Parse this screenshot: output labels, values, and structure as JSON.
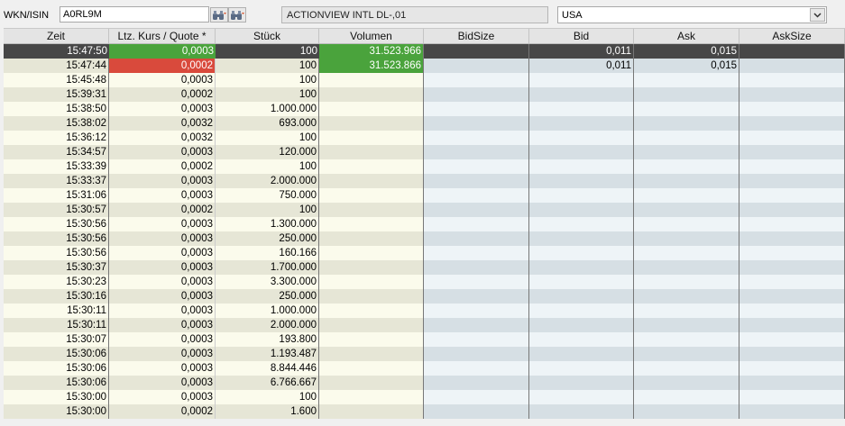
{
  "toolbar": {
    "wkn_label": "WKN/ISIN",
    "wkn_value": "A0RL9M",
    "instrument_name": "ACTIONVIEW INTL   DL-,01",
    "exchange": "USA"
  },
  "columns": [
    "Zeit",
    "Ltz. Kurs / Quote *",
    "Stück",
    "Volumen",
    "BidSize",
    "Bid",
    "Ask",
    "AskSize"
  ],
  "rows": [
    {
      "zeit": "15:47:50",
      "kurs": "0,0003",
      "stueck": "100",
      "volumen": "31.523.966",
      "bidsize": "",
      "bid": "0,011",
      "ask": "0,015",
      "asksize": "",
      "selected": true,
      "kurs_state": "up"
    },
    {
      "zeit": "15:47:44",
      "kurs": "0,0002",
      "stueck": "100",
      "volumen": "31.523.866",
      "bidsize": "",
      "bid": "0,011",
      "ask": "0,015",
      "asksize": "",
      "kurs_state": "down"
    },
    {
      "zeit": "15:45:48",
      "kurs": "0,0003",
      "stueck": "100"
    },
    {
      "zeit": "15:39:31",
      "kurs": "0,0002",
      "stueck": "100"
    },
    {
      "zeit": "15:38:50",
      "kurs": "0,0003",
      "stueck": "1.000.000"
    },
    {
      "zeit": "15:38:02",
      "kurs": "0,0032",
      "stueck": "693.000"
    },
    {
      "zeit": "15:36:12",
      "kurs": "0,0032",
      "stueck": "100"
    },
    {
      "zeit": "15:34:57",
      "kurs": "0,0003",
      "stueck": "120.000"
    },
    {
      "zeit": "15:33:39",
      "kurs": "0,0002",
      "stueck": "100"
    },
    {
      "zeit": "15:33:37",
      "kurs": "0,0003",
      "stueck": "2.000.000"
    },
    {
      "zeit": "15:31:06",
      "kurs": "0,0003",
      "stueck": "750.000"
    },
    {
      "zeit": "15:30:57",
      "kurs": "0,0002",
      "stueck": "100"
    },
    {
      "zeit": "15:30:56",
      "kurs": "0,0003",
      "stueck": "1.300.000"
    },
    {
      "zeit": "15:30:56",
      "kurs": "0,0003",
      "stueck": "250.000"
    },
    {
      "zeit": "15:30:56",
      "kurs": "0,0003",
      "stueck": "160.166"
    },
    {
      "zeit": "15:30:37",
      "kurs": "0,0003",
      "stueck": "1.700.000"
    },
    {
      "zeit": "15:30:23",
      "kurs": "0,0003",
      "stueck": "3.300.000"
    },
    {
      "zeit": "15:30:16",
      "kurs": "0,0003",
      "stueck": "250.000"
    },
    {
      "zeit": "15:30:11",
      "kurs": "0,0003",
      "stueck": "1.000.000"
    },
    {
      "zeit": "15:30:11",
      "kurs": "0,0003",
      "stueck": "2.000.000"
    },
    {
      "zeit": "15:30:07",
      "kurs": "0,0003",
      "stueck": "193.800"
    },
    {
      "zeit": "15:30:06",
      "kurs": "0,0003",
      "stueck": "1.193.487"
    },
    {
      "zeit": "15:30:06",
      "kurs": "0,0003",
      "stueck": "8.844.446"
    },
    {
      "zeit": "15:30:06",
      "kurs": "0,0003",
      "stueck": "6.766.667"
    },
    {
      "zeit": "15:30:00",
      "kurs": "0,0003",
      "stueck": "100"
    },
    {
      "zeit": "15:30:00",
      "kurs": "0,0002",
      "stueck": "1.600"
    }
  ],
  "colors": {
    "selected_row": "#474747",
    "up_green": "#4aa33c",
    "down_red": "#d94a3c",
    "row_cream": "#fbfbec",
    "row_cream_alt": "#e6e6d6",
    "row_blue": "#eef4f7",
    "row_blue_alt": "#d6dfe4"
  }
}
